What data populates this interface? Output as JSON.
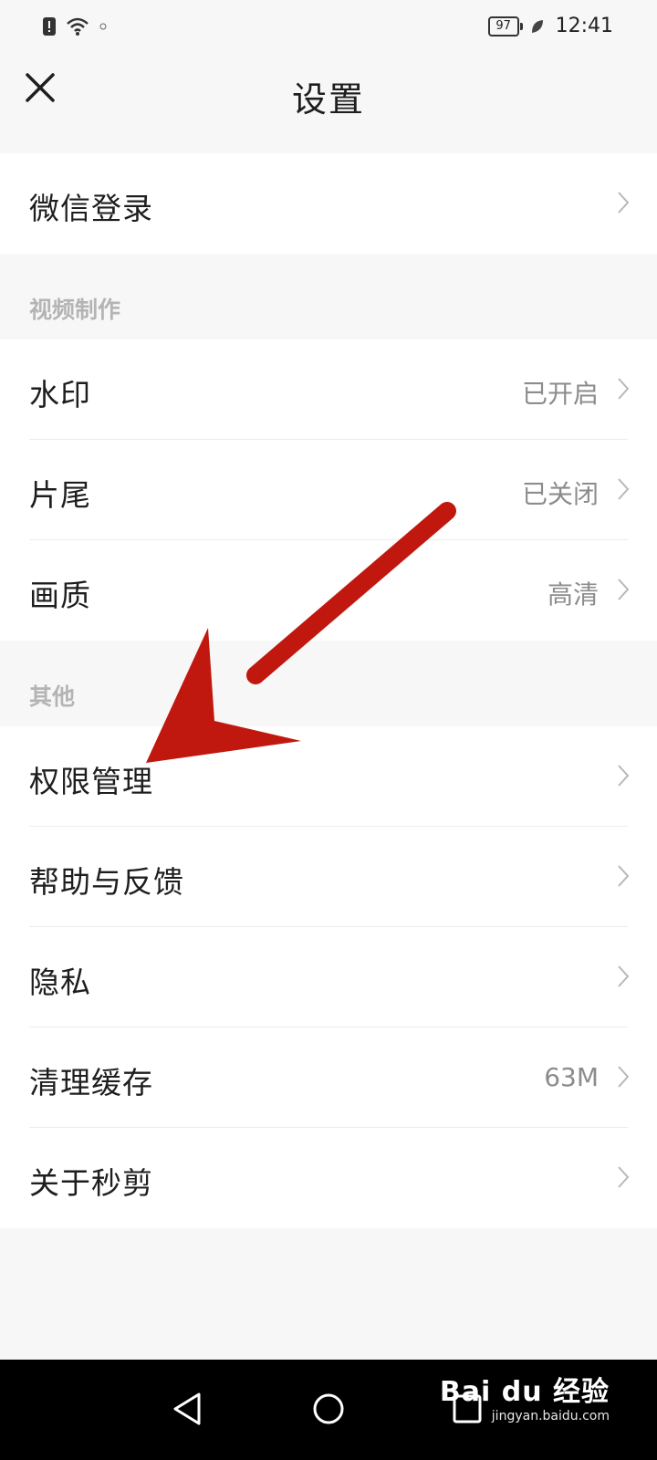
{
  "status_bar": {
    "battery": "97",
    "time": "12:41"
  },
  "header": {
    "title": "设置",
    "close_icon": "close-icon"
  },
  "sections": {
    "account": {
      "items": [
        {
          "label": "微信登录",
          "value": ""
        }
      ]
    },
    "video": {
      "label": "视频制作",
      "items": [
        {
          "label": "水印",
          "value": "已开启"
        },
        {
          "label": "片尾",
          "value": "已关闭"
        },
        {
          "label": "画质",
          "value": "高清"
        }
      ]
    },
    "other": {
      "label": "其他",
      "items": [
        {
          "label": "权限管理",
          "value": ""
        },
        {
          "label": "帮助与反馈",
          "value": ""
        },
        {
          "label": "隐私",
          "value": ""
        },
        {
          "label": "清理缓存",
          "value": "63M"
        },
        {
          "label": "关于秒剪",
          "value": ""
        }
      ]
    }
  },
  "nav_bar": {
    "icons": [
      "back-triangle-icon",
      "home-circle-icon",
      "recents-square-icon"
    ]
  },
  "watermark": {
    "logo": "Bai du 经验",
    "url": "jingyan.baidu.com"
  },
  "colors": {
    "background": "#f7f7f7",
    "row_background": "#ffffff",
    "section_label": "#b4b4b4",
    "value_text": "#8c8c8c",
    "annotation_arrow": "#c0180f"
  }
}
